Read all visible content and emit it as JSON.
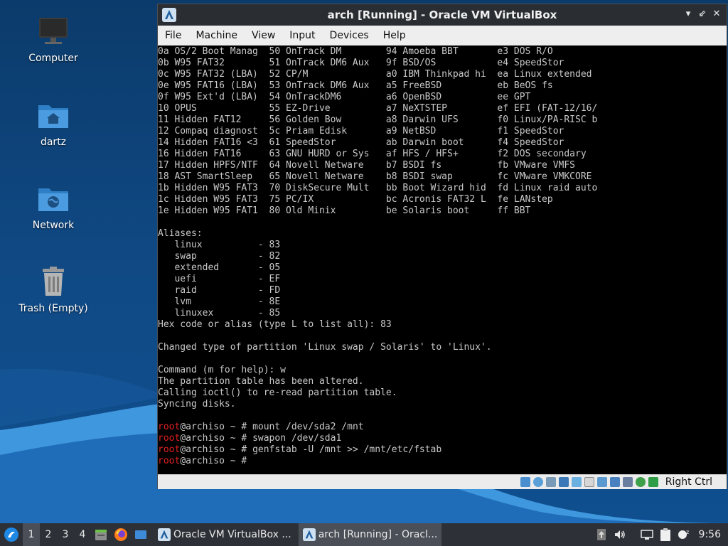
{
  "desktop": {
    "icons": [
      {
        "label": "Computer",
        "icon": "computer-icon"
      },
      {
        "label": "dartz",
        "icon": "home-folder-icon"
      },
      {
        "label": "Network",
        "icon": "network-folder-icon"
      },
      {
        "label": "Trash (Empty)",
        "icon": "trash-icon"
      }
    ]
  },
  "window": {
    "title": "arch [Running] - Oracle VM VirtualBox",
    "menu": [
      "File",
      "Machine",
      "View",
      "Input",
      "Devices",
      "Help"
    ],
    "controls": [
      "minimize",
      "restore",
      "close"
    ],
    "host_key": "Right Ctrl"
  },
  "terminal": {
    "lines": [
      "0a OS/2 Boot Manag  50 OnTrack DM        94 Amoeba BBT       e3 DOS R/O",
      "0b W95 FAT32        51 OnTrack DM6 Aux   9f BSD/OS           e4 SpeedStor",
      "0c W95 FAT32 (LBA)  52 CP/M              a0 IBM Thinkpad hi  ea Linux extended",
      "0e W95 FAT16 (LBA)  53 OnTrack DM6 Aux   a5 FreeBSD          eb BeOS fs",
      "0f W95 Ext'd (LBA)  54 OnTrackDM6        a6 OpenBSD          ee GPT",
      "10 OPUS             55 EZ-Drive          a7 NeXTSTEP         ef EFI (FAT-12/16/",
      "11 Hidden FAT12     56 Golden Bow        a8 Darwin UFS       f0 Linux/PA-RISC b",
      "12 Compaq diagnost  5c Priam Edisk       a9 NetBSD           f1 SpeedStor",
      "14 Hidden FAT16 <3  61 SpeedStor         ab Darwin boot      f4 SpeedStor",
      "16 Hidden FAT16     63 GNU HURD or Sys   af HFS / HFS+       f2 DOS secondary",
      "17 Hidden HPFS/NTF  64 Novell Netware    b7 BSDI fs          fb VMware VMFS",
      "18 AST SmartSleep   65 Novell Netware    b8 BSDI swap        fc VMware VMKCORE",
      "1b Hidden W95 FAT3  70 DiskSecure Mult   bb Boot Wizard hid  fd Linux raid auto",
      "1c Hidden W95 FAT3  75 PC/IX             bc Acronis FAT32 L  fe LANstep",
      "1e Hidden W95 FAT1  80 Old Minix         be Solaris boot     ff BBT",
      "",
      "Aliases:",
      "   linux          - 83",
      "   swap           - 82",
      "   extended       - 05",
      "   uefi           - EF",
      "   raid           - FD",
      "   lvm            - 8E",
      "   linuxex        - 85",
      "Hex code or alias (type L to list all): 83",
      "",
      "Changed type of partition 'Linux swap / Solaris' to 'Linux'.",
      "",
      "Command (m for help): w",
      "The partition table has been altered.",
      "Calling ioctl() to re-read partition table.",
      "Syncing disks.",
      ""
    ],
    "prompt_user": "root",
    "prompt_rest": "@archiso ~ # ",
    "commands": [
      "mount /dev/sda2 /mnt",
      "swapon /dev/sda1",
      "genfstab -U /mnt >> /mnt/etc/fstab",
      ""
    ]
  },
  "taskbar": {
    "workspaces": [
      "1",
      "2",
      "3",
      "4"
    ],
    "active_workspace": "1",
    "tasks": [
      {
        "label": "Oracle VM VirtualBox ...",
        "active": false
      },
      {
        "label": "arch [Running] - Oracl...",
        "active": true
      }
    ],
    "clock": "9:56"
  },
  "colors": {
    "desktop_bg": "#0e3f73",
    "wave_light": "#4aa3e8",
    "prompt_user": "#e02020",
    "terminal_bg": "#000000",
    "terminal_fg": "#c9c9c9"
  }
}
